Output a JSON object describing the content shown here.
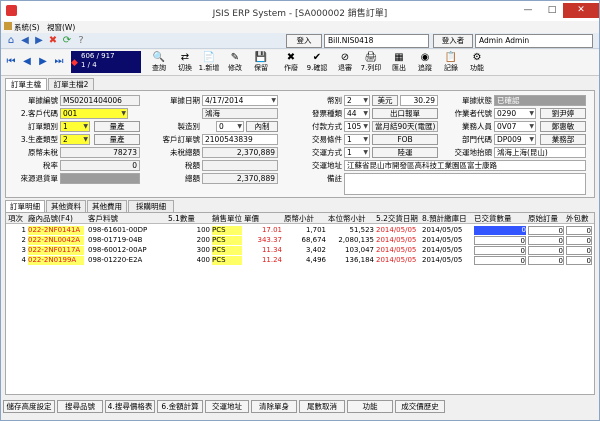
{
  "window": {
    "title": "JSIS ERP System - [SA000002 銷售訂單]",
    "controls": [
      "—",
      "□",
      "✕"
    ]
  },
  "menu": {
    "system": "系統(S)",
    "window": "視窗(W)"
  },
  "nav": {
    "login_label": "登入",
    "login_value": "Bill.NIS0418",
    "logger_label": "登入者",
    "logger_value": "Admin Admin"
  },
  "record": {
    "position": "606 / 917",
    "page": "1 / 4"
  },
  "toolbar": [
    {
      "icon": "query-icon",
      "glyph": "🔍",
      "label": "查詢"
    },
    {
      "icon": "switch-icon",
      "glyph": "⇄",
      "label": "切換"
    },
    {
      "icon": "new-icon",
      "glyph": "📄",
      "label": "1.新增"
    },
    {
      "icon": "edit-icon",
      "glyph": "✎",
      "label": "修改"
    },
    {
      "icon": "save-icon",
      "glyph": "💾",
      "label": "保留"
    },
    {
      "icon": "void-icon",
      "glyph": "✖",
      "label": "作廢"
    },
    {
      "icon": "confirm-icon",
      "glyph": "✔",
      "label": "9.確認"
    },
    {
      "icon": "cancel-confirm-icon",
      "glyph": "⊘",
      "label": "退審"
    },
    {
      "icon": "print-icon",
      "glyph": "🖨",
      "label": "7.列印"
    },
    {
      "icon": "export-icon",
      "glyph": "▦",
      "label": "匯出"
    },
    {
      "icon": "trace-icon",
      "glyph": "◉",
      "label": "追蹤"
    },
    {
      "icon": "log-icon",
      "glyph": "📋",
      "label": "記錄"
    },
    {
      "icon": "function-icon",
      "glyph": "⚙",
      "label": "功能"
    }
  ],
  "tabs": [
    "訂單主檔",
    "訂單主檔2"
  ],
  "form": {
    "order_no_label": "單據編號",
    "order_no": "MS0201404006",
    "order_date_label": "單據日期",
    "order_date": "4/17/2014",
    "customer_label": "2.客戶代碼",
    "customer_code": "001",
    "customer_name": "鴻海",
    "order_type_label": "訂單類別",
    "order_type": "1",
    "order_type_btn": "量產",
    "prod_type_label": "3.生產類型",
    "prod_type": "2",
    "prod_type_btn": "量產",
    "tax_label": "製造別",
    "tax_value": "0",
    "tax_btn": "內制",
    "cust_po_label": "客戶訂單號",
    "cust_po": "2100543839",
    "src_amt_label": "原幣未稅",
    "src_amt": "78273",
    "untaxed_label": "未稅總額",
    "untaxed": "2,370,889",
    "tax_rate_label": "稅率",
    "tax_rate": "0",
    "tax_amt_label": "稅額",
    "tax_amt": "",
    "src_ship_label": "來源退貨單",
    "src_ship": "",
    "total_label": "總額",
    "total": "2,370,889",
    "currency_label": "幣別",
    "currency_code": "2",
    "currency_btn": "美元",
    "rate": "30.29",
    "invoice_label": "發票種類",
    "invoice_code": "44",
    "invoice_btn": "出口報單",
    "pay_label": "付款方式",
    "pay_code": "105",
    "pay_text": "當月結90天(電匯)",
    "trade_label": "交易條件",
    "trade_code": "1",
    "trade_text": "FOB",
    "ship_label": "交運方式",
    "ship_code": "1",
    "ship_text": "陸運",
    "ship_addr_label": "交運地址",
    "ship_addr": "江蘇省昆山市開發區高科技工業園區富士康路",
    "remark_label": "備註",
    "remark": "",
    "status_label": "單據狀態",
    "status": "已確認",
    "operator_label": "作業者代號",
    "operator_code": "0290",
    "operator_name": "劉尹婷",
    "sales_label": "業務人員",
    "sales_code": "0V07",
    "sales_name": "鄭惠敏",
    "dept_label": "部門代碼",
    "dept_code": "DP009",
    "dept_name": "業務部",
    "dest_label": "交運地抬頭",
    "dest": "鴻海上海(昆山)"
  },
  "lower_tabs": [
    "訂單明細",
    "其他資料",
    "其他費用",
    "採購明細"
  ],
  "grid": {
    "headers": [
      "項次",
      "廠內品號(F4)",
      "客戶料號",
      "5.1數量",
      "銷售單位",
      "單價",
      "原幣小計",
      "本位幣小計",
      "5.2交貨日期",
      "8.預計繳庫日",
      "已交貨數量",
      "原始訂量",
      "外包數"
    ],
    "rows": [
      [
        "1",
        "022-2NF0141A",
        "098-61601-00DP",
        "100",
        "PCS",
        "17.01",
        "1,701",
        "51,523",
        "2014/05/05",
        "2014/05/05",
        "0",
        "0",
        "0"
      ],
      [
        "2",
        "022-2NL0042A",
        "098-01719-04B",
        "200",
        "PCS",
        "343.37",
        "68,674",
        "2,080,135",
        "2014/05/05",
        "2014/05/05",
        "0",
        "0",
        "0"
      ],
      [
        "3",
        "022-2NF0117A",
        "098-60012-00AP",
        "300",
        "PCS",
        "11.34",
        "3,402",
        "103,047",
        "2014/05/05",
        "2014/05/05",
        "0",
        "0",
        "0"
      ],
      [
        "4",
        "022-2N0199A",
        "098-01220-E2A",
        "400",
        "PCS",
        "11.24",
        "4,496",
        "136,184",
        "2014/05/05",
        "2014/05/05",
        "0",
        "0",
        "0"
      ]
    ]
  },
  "bottom_buttons": [
    "儲存高度設定",
    "搜尋品號",
    "4.搜尋價格表",
    "6.金額計算",
    "交運地址",
    "清除單身",
    "尾數取消",
    "功能",
    "成交價歷史"
  ]
}
